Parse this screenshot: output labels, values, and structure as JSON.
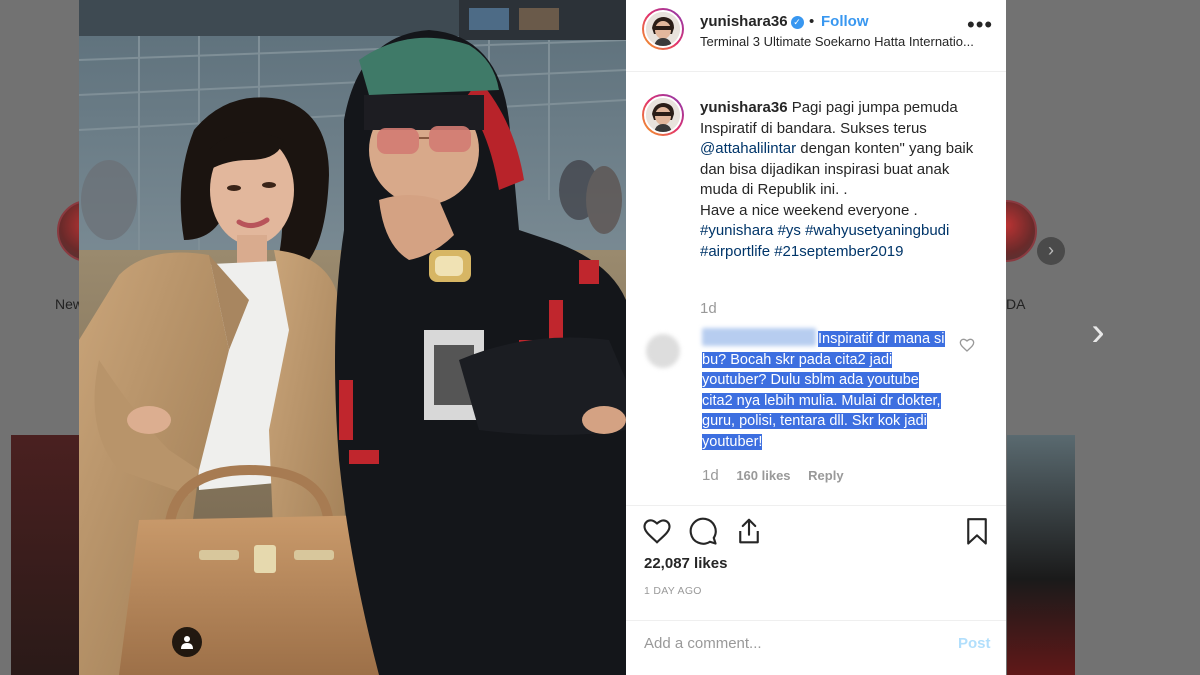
{
  "background": {
    "story_left_label": "New",
    "story_right_label": "DA",
    "story_next": "›",
    "modal_next": "›"
  },
  "post": {
    "username": "yunishara36",
    "verified": true,
    "follow_label": "Follow",
    "separator": "•",
    "location": "Terminal 3 Ultimate Soekarno Hatta Internatio...",
    "more_label": "•••",
    "caption": {
      "username": "yunishara36",
      "line1": " Pagi pagi jumpa pemuda Inspiratif di bandara. Sukses terus ",
      "mention": "@attahalilintar",
      "line2": " dengan konten\" yang baik dan bisa dijadikan inspirasi buat anak muda di Republik ini. .",
      "line3": "Have a nice weekend everyone .",
      "hashtags": [
        "#yunishara",
        "#ys",
        "#wahyusetyaningbudi",
        "#airportlife",
        "#21september2019"
      ],
      "time": "1d"
    },
    "comment": {
      "text": "Inspiratif dr mana si bu? Bocah skr pada cita2 jadi youtuber? Dulu sblm ada youtube cita2 nya lebih mulia. Mulai dr dokter, guru, polisi, tentara dll. Skr kok jadi youtuber!",
      "time": "1d",
      "likes": "160 likes",
      "reply_label": "Reply"
    },
    "likes": "22,087 likes",
    "date": "1 DAY AGO",
    "add_comment_placeholder": "Add a comment...",
    "post_label": "Post"
  },
  "icons": {
    "like": "heart-icon",
    "comment": "comment-icon",
    "share": "share-icon",
    "save": "bookmark-icon",
    "tag": "person-tag-icon"
  },
  "colors": {
    "link": "#003569",
    "follow": "#3897f0",
    "highlight": "#3d6fe0",
    "muted": "#999999"
  }
}
